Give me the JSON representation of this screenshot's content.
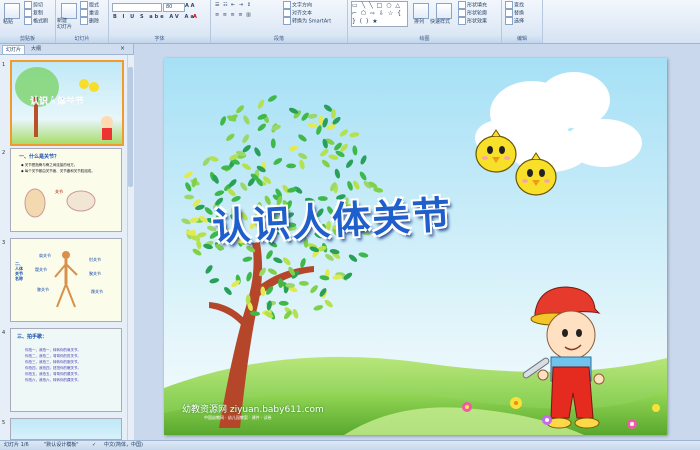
{
  "ribbon": {
    "clipboard": {
      "label": "剪贴板",
      "paste": "粘贴",
      "cut": "剪切",
      "copy": "复制",
      "format_painter": "格式刷"
    },
    "slides": {
      "label": "幻灯片",
      "new_slide": "新建\n幻灯片",
      "layout": "版式",
      "reset": "重设",
      "delete": "删除"
    },
    "font": {
      "label": "字体",
      "font_size": "80"
    },
    "paragraph": {
      "label": "段落",
      "text_direction": "文字方向",
      "align_text": "对齐文本",
      "smartart": "转换为 SmartArt"
    },
    "drawing": {
      "label": "绘图",
      "arrange": "排列",
      "quick_styles": "快速样式",
      "shape_fill": "形状填充",
      "shape_outline": "形状轮廓",
      "shape_effects": "形状效果"
    },
    "editing": {
      "label": "编辑",
      "find": "查找",
      "replace": "替换",
      "select": "选择"
    }
  },
  "panel": {
    "tabs": [
      "幻灯片",
      "大纲"
    ],
    "thumbs": [
      {
        "num": "1",
        "title": "认识人体关节"
      },
      {
        "num": "2",
        "title": "一、什么是关节？",
        "bullet1": "◆ 关节是指骨与骨之间连接的地方。",
        "bullet2": "◆ 每个关节都由关节面、关节囊和关节腔组成。",
        "label": "关节"
      },
      {
        "num": "3",
        "title": "二、人体关节名称",
        "labels": [
          "肩关节",
          "肘关节",
          "髋关节",
          "腕关节",
          "膝关节",
          "踝关节"
        ]
      },
      {
        "num": "4",
        "title": "三、拍手歌：",
        "lines": [
          "你拍一，我拍一，转转你的肩关节。",
          "你拍二，我拍二，弯弯你的肘关节。",
          "你拍三，我拍三，转转你的腕关节。",
          "你拍四，我拍四，扭扭你的髋关节。",
          "你拍五，我拍五，弯弯你的膝关节。",
          "你拍六，我拍六，转转你的踝关节。"
        ]
      },
      {
        "num": "5"
      }
    ]
  },
  "slide": {
    "title": "认识人体关节",
    "watermark": "幼教资源网 ziyuan.baby611.com",
    "watermark_sub": "中国幼教网 · 幼儿园教案 · 课件 · 试卷"
  },
  "status": {
    "slide_info": "幻灯片 1/6",
    "theme": "\"默认设计模板\"",
    "language": "中文(简体，中国)"
  },
  "colors": {
    "selected_border": "#f29a2b",
    "sky": "#aee3f5",
    "grass": "#8fd14f",
    "title_blue": "#1f5fcc"
  }
}
